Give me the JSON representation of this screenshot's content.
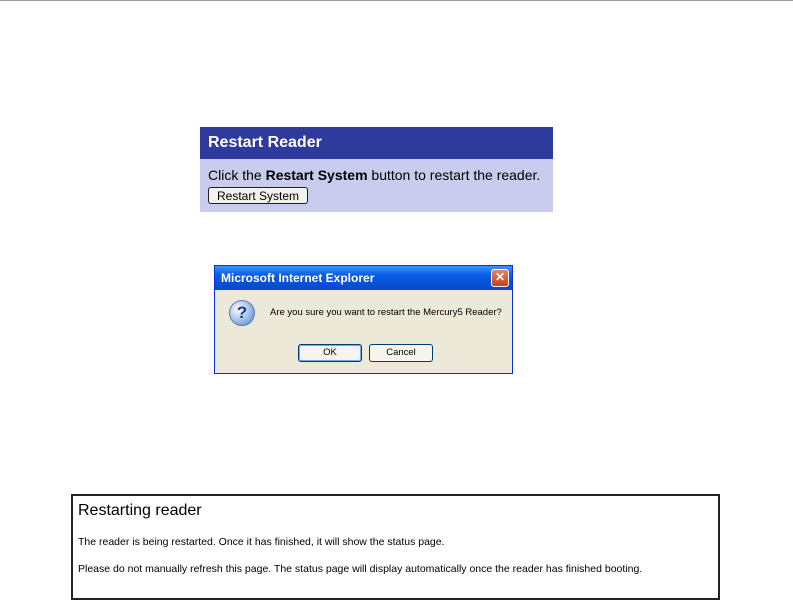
{
  "restart_panel": {
    "title": "Restart Reader",
    "instruction_pre": "Click the ",
    "instruction_bold": "Restart System",
    "instruction_post": " button to restart the reader.",
    "button_label": "Restart System"
  },
  "confirm_dialog": {
    "title": "Microsoft Internet Explorer",
    "close_glyph": "✕",
    "icon": "question-icon",
    "message": "Are you sure you want to restart the Mercury5 Reader?",
    "ok_label": "OK",
    "cancel_label": "Cancel"
  },
  "restarting_notice": {
    "title": "Restarting reader",
    "paragraph1": "The reader is being restarted. Once it has finished, it will show the status page.",
    "paragraph2": "Please do not manually refresh this page. The status page will display automatically once the reader has finished booting."
  },
  "colors": {
    "panel_header": "#2e3a9c",
    "panel_body": "#c9ccee",
    "dialog_face": "#ece9d8",
    "dialog_titlebar": "#0a5fe8"
  }
}
